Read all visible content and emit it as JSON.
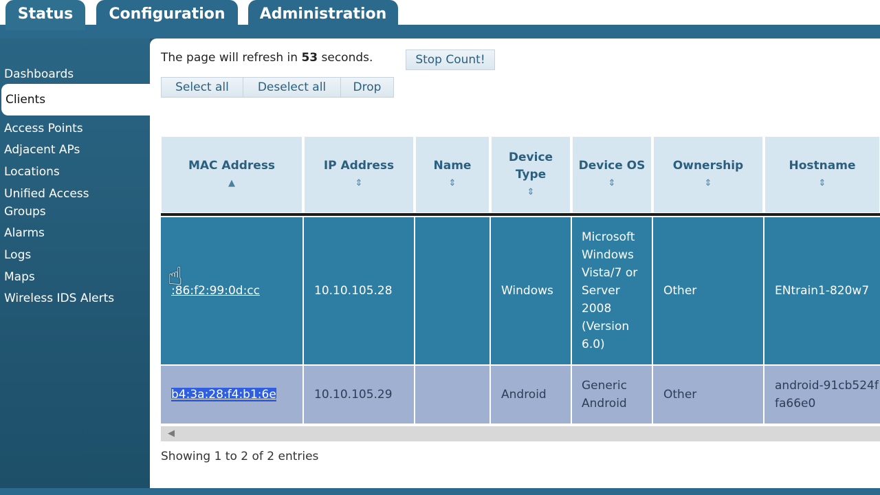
{
  "tabs": [
    {
      "label": "Status"
    },
    {
      "label": "Configuration"
    },
    {
      "label": "Administration"
    }
  ],
  "sidebar": {
    "items": [
      {
        "label": "Dashboards"
      },
      {
        "label": "Clients"
      },
      {
        "label": "Access Points"
      },
      {
        "label": "Adjacent APs"
      },
      {
        "label": "Locations"
      },
      {
        "label": "Unified Access Groups"
      },
      {
        "label": "Alarms"
      },
      {
        "label": "Logs"
      },
      {
        "label": "Maps"
      },
      {
        "label": "Wireless IDS Alerts"
      }
    ]
  },
  "refresh": {
    "prefix": "The page will refresh in",
    "seconds": "53",
    "suffix": "seconds.",
    "stop_label": "Stop Count!"
  },
  "actions": {
    "select_all": "Select all",
    "deselect_all": "Deselect all",
    "drop": "Drop"
  },
  "table": {
    "headers": [
      "MAC Address",
      "IP Address",
      "Name",
      "Device Type",
      "Device OS",
      "Ownership",
      "Hostname"
    ],
    "rows": [
      {
        "mac": ":86:f2:99:0d:cc",
        "ip": "10.10.105.28",
        "name": "",
        "device_type": "Windows",
        "device_os": "Microsoft Windows Vista/7 or Server 2008 (Version 6.0)",
        "ownership": "Other",
        "hostname": "ENtrain1-820w7"
      },
      {
        "mac": "b4:3a:28:f4:b1:6e",
        "ip": "10.10.105.29",
        "name": "",
        "device_type": "Android",
        "device_os": "Generic Android",
        "ownership": "Other",
        "hostname": "android-91cb524ffa66e0"
      }
    ]
  },
  "footer": {
    "showing": "Showing 1 to 2 of 2 entries"
  },
  "icons": {
    "sort": "sort-icon",
    "cursor": "hand-cursor-icon"
  }
}
